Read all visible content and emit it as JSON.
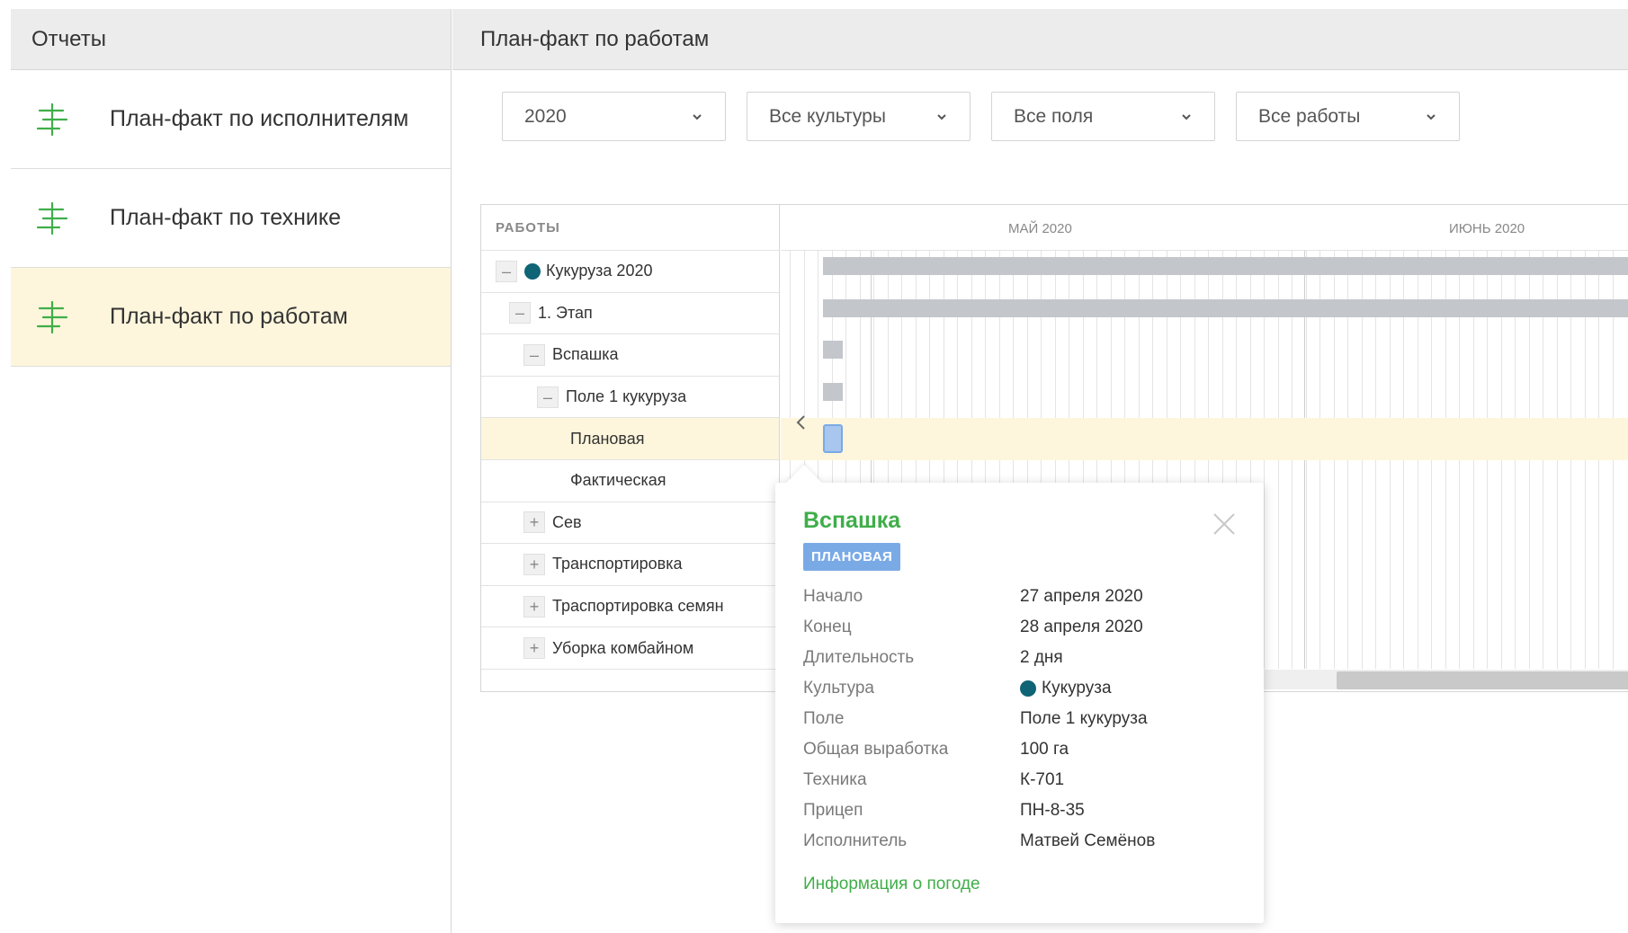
{
  "sidebar": {
    "title": "Отчеты",
    "items": [
      {
        "label": "План-факт по исполнителям",
        "active": false
      },
      {
        "label": "План-факт по технике",
        "active": false
      },
      {
        "label": "План-факт по работам",
        "active": true
      }
    ]
  },
  "main": {
    "title": "План-факт по работам",
    "filters": {
      "year": "2020",
      "crops": "Все культуры",
      "fields": "Все поля",
      "works": "Все работы"
    }
  },
  "gantt": {
    "column_header": "РАБОТЫ",
    "months": [
      "МАЙ 2020",
      "ИЮНЬ 2020"
    ],
    "rows": [
      {
        "label": "Кукуруза 2020",
        "toggle": "–",
        "dot": true
      },
      {
        "label": "1. Этап",
        "toggle": "–"
      },
      {
        "label": "Вспашка",
        "toggle": "–"
      },
      {
        "label": "Поле 1 кукуруза",
        "toggle": "–"
      },
      {
        "label": "Плановая",
        "highlighted": true
      },
      {
        "label": "Фактическая"
      },
      {
        "label": "Сев",
        "toggle": "+"
      },
      {
        "label": "Транспортировка",
        "toggle": "+"
      },
      {
        "label": "Траспортировка семян",
        "toggle": "+"
      },
      {
        "label": "Уборка комбайном",
        "toggle": "+"
      }
    ]
  },
  "popup": {
    "title": "Вспашка",
    "badge": "ПЛАНОВАЯ",
    "props": [
      {
        "key": "Начало",
        "value": "27 апреля 2020"
      },
      {
        "key": "Конец",
        "value": "28 апреля 2020"
      },
      {
        "key": "Длительность",
        "value": "2 дня"
      },
      {
        "key": "Культура",
        "value": "Кукуруза"
      },
      {
        "key": "Поле",
        "value": "Поле 1 кукуруза"
      },
      {
        "key": "Общая выработка",
        "value": "100 га"
      },
      {
        "key": "Техника",
        "value": "К-701"
      },
      {
        "key": "Прицеп",
        "value": "ПН-8-35"
      },
      {
        "key": "Исполнитель",
        "value": "Матвей Семёнов"
      }
    ],
    "weather_link": "Информация о погоде"
  },
  "colors": {
    "accent_green": "#3fae49",
    "crop_dot": "#0f6475",
    "badge_blue": "#7aaae6",
    "highlight": "#fdf6dc"
  }
}
